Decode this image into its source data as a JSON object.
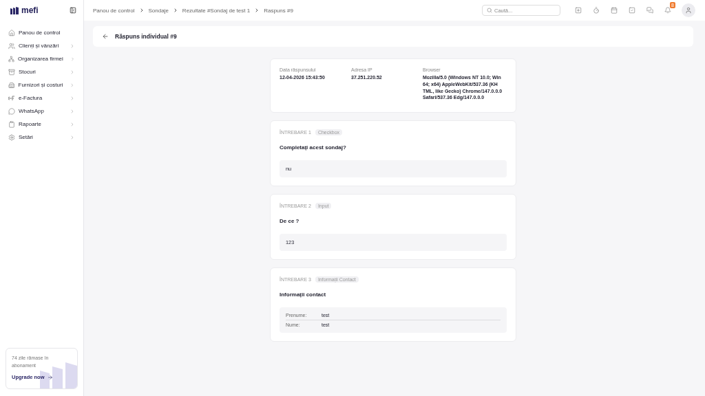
{
  "sidebar": {
    "logo": "mefi",
    "items": [
      {
        "label": "Panou de control",
        "expandable": false
      },
      {
        "label": "Clienți și vânzări",
        "expandable": true
      },
      {
        "label": "Organizarea firmei",
        "expandable": true
      },
      {
        "label": "Stocuri",
        "expandable": true
      },
      {
        "label": "Furnizori și costuri",
        "expandable": true
      },
      {
        "label": "e-Factura",
        "expandable": true
      },
      {
        "label": "WhatsApp",
        "expandable": true
      },
      {
        "label": "Rapoarte",
        "expandable": true
      },
      {
        "label": "Setări",
        "expandable": true
      }
    ],
    "promo": {
      "text": "74 zile rămase în abonament",
      "link": "Upgrade now"
    }
  },
  "breadcrumbs": [
    "Panou de control",
    "Sondaje",
    "Rezultate #Sondaj de test 1",
    "Raspuns #9"
  ],
  "search": {
    "placeholder": "Caută..."
  },
  "notifications": {
    "count": "8"
  },
  "page_title": "Răspuns individual #9",
  "meta": [
    {
      "label": "Data răspunsului",
      "value": "12-04-2026 15:43:50"
    },
    {
      "label": "Adresa IP",
      "value": "37.251.220.52"
    },
    {
      "label": "Browser",
      "value": "Mozilla/5.0 (Windows NT 10.0; Win 64; x64) AppleWebKit/537.36 (KH TML, like Gecko) Chrome/147.0.0.0 Safari/537.36 Edg/147.0.0.0"
    }
  ],
  "questions": [
    {
      "number": "ÎNTREBARE 1",
      "type": "Checkbox",
      "title": "Completați acest sondaj?",
      "kind": "text",
      "answer": "nu"
    },
    {
      "number": "ÎNTREBARE 2",
      "type": "Input",
      "title": "De ce ?",
      "kind": "text",
      "answer": "123"
    },
    {
      "number": "ÎNTREBARE 3",
      "type": "Informații Contact",
      "title": "Informații contact",
      "kind": "contact",
      "fields": [
        {
          "label": "Prenume:",
          "value": "test"
        },
        {
          "label": "Nume:",
          "value": "test"
        }
      ]
    }
  ]
}
